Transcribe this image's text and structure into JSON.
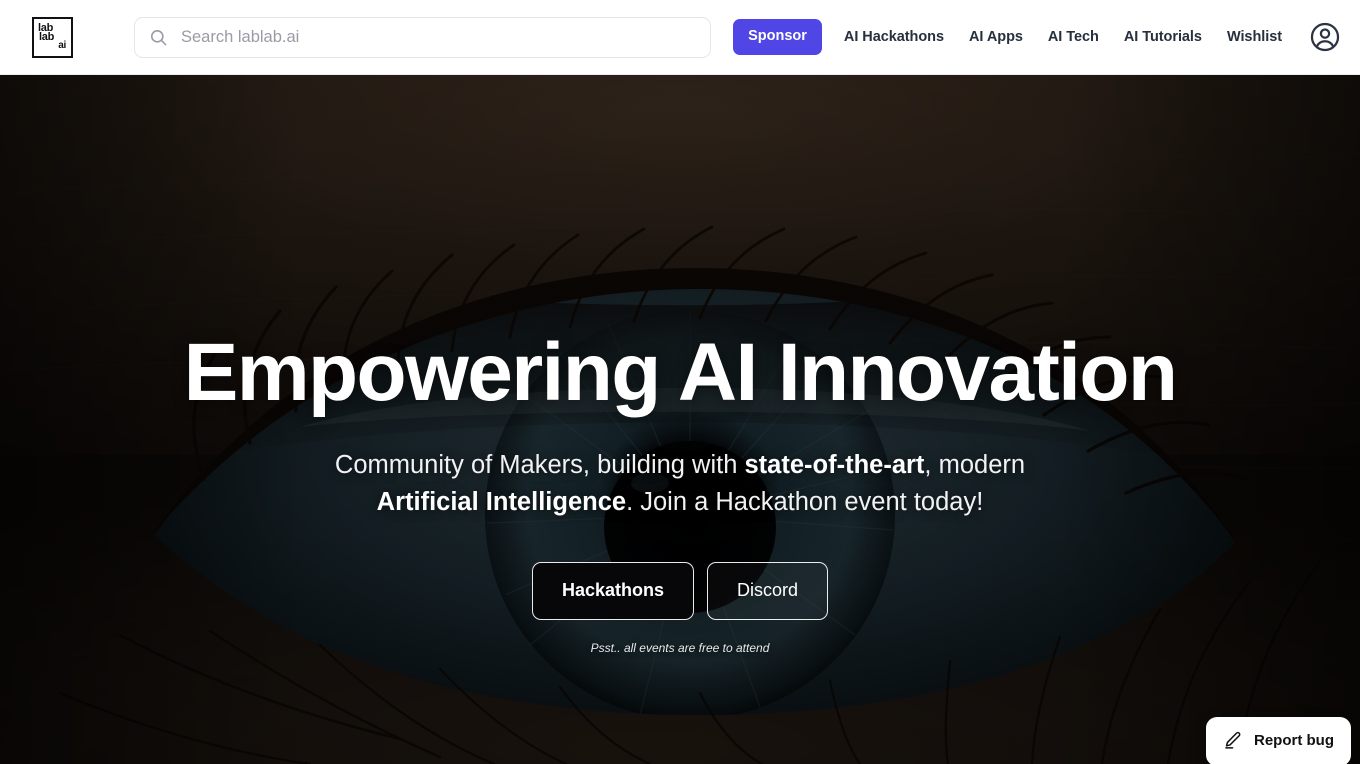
{
  "brand": {
    "logo_lines": [
      "lab",
      "lab",
      "ai"
    ],
    "logo_alt": "lablab.ai"
  },
  "colors": {
    "accent": "#4f46e5",
    "nav_text": "#27303f",
    "hero_overlay": "#231a13",
    "eyelid_skin": "#2a2018",
    "iris": "#1d3640"
  },
  "search": {
    "placeholder": "Search lablab.ai",
    "value": "",
    "icon": "search-icon"
  },
  "nav": {
    "sponsor_label": "Sponsor",
    "links": [
      {
        "label": "AI Hackathons"
      },
      {
        "label": "AI Apps"
      },
      {
        "label": "AI Tech"
      },
      {
        "label": "AI Tutorials"
      },
      {
        "label": "Wishlist"
      }
    ],
    "avatar_icon": "user-avatar-icon"
  },
  "hero": {
    "title": "Empowering AI Innovation",
    "subtitle": {
      "part1": "Community of Makers, building with ",
      "bold1": "state-of-the-art",
      "part2": ", modern ",
      "bold2": "Artificial Intelligence",
      "part3": ". Join a Hackathon event today!"
    },
    "buttons": {
      "primary": "Hackathons",
      "secondary": "Discord"
    },
    "note": "Psst.. all events are free to attend",
    "background_description": "close-up photograph of a human eye with blue-green iris"
  },
  "report_bug": {
    "label": "Report bug",
    "icon": "pencil-icon"
  }
}
